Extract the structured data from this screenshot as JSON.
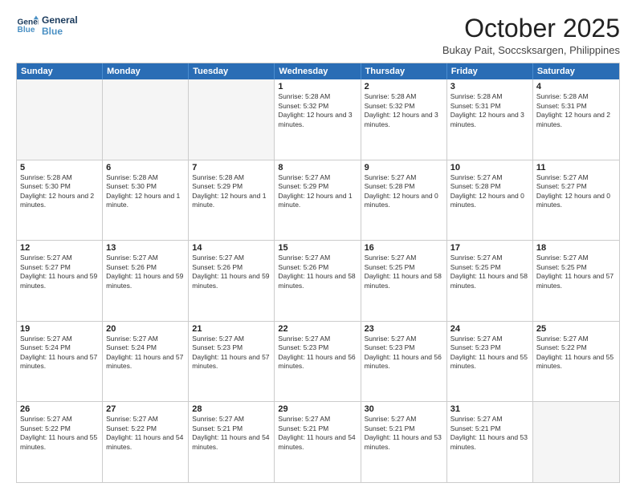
{
  "logo": {
    "line1": "General",
    "line2": "Blue"
  },
  "title": "October 2025",
  "subtitle": "Bukay Pait, Soccsksargen, Philippines",
  "header": {
    "days": [
      "Sunday",
      "Monday",
      "Tuesday",
      "Wednesday",
      "Thursday",
      "Friday",
      "Saturday"
    ]
  },
  "rows": [
    [
      {
        "day": "",
        "sunrise": "",
        "sunset": "",
        "daylight": "",
        "empty": true
      },
      {
        "day": "",
        "sunrise": "",
        "sunset": "",
        "daylight": "",
        "empty": true
      },
      {
        "day": "",
        "sunrise": "",
        "sunset": "",
        "daylight": "",
        "empty": true
      },
      {
        "day": "1",
        "sunrise": "Sunrise: 5:28 AM",
        "sunset": "Sunset: 5:32 PM",
        "daylight": "Daylight: 12 hours and 3 minutes."
      },
      {
        "day": "2",
        "sunrise": "Sunrise: 5:28 AM",
        "sunset": "Sunset: 5:32 PM",
        "daylight": "Daylight: 12 hours and 3 minutes."
      },
      {
        "day": "3",
        "sunrise": "Sunrise: 5:28 AM",
        "sunset": "Sunset: 5:31 PM",
        "daylight": "Daylight: 12 hours and 3 minutes."
      },
      {
        "day": "4",
        "sunrise": "Sunrise: 5:28 AM",
        "sunset": "Sunset: 5:31 PM",
        "daylight": "Daylight: 12 hours and 2 minutes."
      }
    ],
    [
      {
        "day": "5",
        "sunrise": "Sunrise: 5:28 AM",
        "sunset": "Sunset: 5:30 PM",
        "daylight": "Daylight: 12 hours and 2 minutes."
      },
      {
        "day": "6",
        "sunrise": "Sunrise: 5:28 AM",
        "sunset": "Sunset: 5:30 PM",
        "daylight": "Daylight: 12 hours and 1 minute."
      },
      {
        "day": "7",
        "sunrise": "Sunrise: 5:28 AM",
        "sunset": "Sunset: 5:29 PM",
        "daylight": "Daylight: 12 hours and 1 minute."
      },
      {
        "day": "8",
        "sunrise": "Sunrise: 5:27 AM",
        "sunset": "Sunset: 5:29 PM",
        "daylight": "Daylight: 12 hours and 1 minute."
      },
      {
        "day": "9",
        "sunrise": "Sunrise: 5:27 AM",
        "sunset": "Sunset: 5:28 PM",
        "daylight": "Daylight: 12 hours and 0 minutes."
      },
      {
        "day": "10",
        "sunrise": "Sunrise: 5:27 AM",
        "sunset": "Sunset: 5:28 PM",
        "daylight": "Daylight: 12 hours and 0 minutes."
      },
      {
        "day": "11",
        "sunrise": "Sunrise: 5:27 AM",
        "sunset": "Sunset: 5:27 PM",
        "daylight": "Daylight: 12 hours and 0 minutes."
      }
    ],
    [
      {
        "day": "12",
        "sunrise": "Sunrise: 5:27 AM",
        "sunset": "Sunset: 5:27 PM",
        "daylight": "Daylight: 11 hours and 59 minutes."
      },
      {
        "day": "13",
        "sunrise": "Sunrise: 5:27 AM",
        "sunset": "Sunset: 5:26 PM",
        "daylight": "Daylight: 11 hours and 59 minutes."
      },
      {
        "day": "14",
        "sunrise": "Sunrise: 5:27 AM",
        "sunset": "Sunset: 5:26 PM",
        "daylight": "Daylight: 11 hours and 59 minutes."
      },
      {
        "day": "15",
        "sunrise": "Sunrise: 5:27 AM",
        "sunset": "Sunset: 5:26 PM",
        "daylight": "Daylight: 11 hours and 58 minutes."
      },
      {
        "day": "16",
        "sunrise": "Sunrise: 5:27 AM",
        "sunset": "Sunset: 5:25 PM",
        "daylight": "Daylight: 11 hours and 58 minutes."
      },
      {
        "day": "17",
        "sunrise": "Sunrise: 5:27 AM",
        "sunset": "Sunset: 5:25 PM",
        "daylight": "Daylight: 11 hours and 58 minutes."
      },
      {
        "day": "18",
        "sunrise": "Sunrise: 5:27 AM",
        "sunset": "Sunset: 5:25 PM",
        "daylight": "Daylight: 11 hours and 57 minutes."
      }
    ],
    [
      {
        "day": "19",
        "sunrise": "Sunrise: 5:27 AM",
        "sunset": "Sunset: 5:24 PM",
        "daylight": "Daylight: 11 hours and 57 minutes."
      },
      {
        "day": "20",
        "sunrise": "Sunrise: 5:27 AM",
        "sunset": "Sunset: 5:24 PM",
        "daylight": "Daylight: 11 hours and 57 minutes."
      },
      {
        "day": "21",
        "sunrise": "Sunrise: 5:27 AM",
        "sunset": "Sunset: 5:23 PM",
        "daylight": "Daylight: 11 hours and 57 minutes."
      },
      {
        "day": "22",
        "sunrise": "Sunrise: 5:27 AM",
        "sunset": "Sunset: 5:23 PM",
        "daylight": "Daylight: 11 hours and 56 minutes."
      },
      {
        "day": "23",
        "sunrise": "Sunrise: 5:27 AM",
        "sunset": "Sunset: 5:23 PM",
        "daylight": "Daylight: 11 hours and 56 minutes."
      },
      {
        "day": "24",
        "sunrise": "Sunrise: 5:27 AM",
        "sunset": "Sunset: 5:23 PM",
        "daylight": "Daylight: 11 hours and 55 minutes."
      },
      {
        "day": "25",
        "sunrise": "Sunrise: 5:27 AM",
        "sunset": "Sunset: 5:22 PM",
        "daylight": "Daylight: 11 hours and 55 minutes."
      }
    ],
    [
      {
        "day": "26",
        "sunrise": "Sunrise: 5:27 AM",
        "sunset": "Sunset: 5:22 PM",
        "daylight": "Daylight: 11 hours and 55 minutes."
      },
      {
        "day": "27",
        "sunrise": "Sunrise: 5:27 AM",
        "sunset": "Sunset: 5:22 PM",
        "daylight": "Daylight: 11 hours and 54 minutes."
      },
      {
        "day": "28",
        "sunrise": "Sunrise: 5:27 AM",
        "sunset": "Sunset: 5:21 PM",
        "daylight": "Daylight: 11 hours and 54 minutes."
      },
      {
        "day": "29",
        "sunrise": "Sunrise: 5:27 AM",
        "sunset": "Sunset: 5:21 PM",
        "daylight": "Daylight: 11 hours and 54 minutes."
      },
      {
        "day": "30",
        "sunrise": "Sunrise: 5:27 AM",
        "sunset": "Sunset: 5:21 PM",
        "daylight": "Daylight: 11 hours and 53 minutes."
      },
      {
        "day": "31",
        "sunrise": "Sunrise: 5:27 AM",
        "sunset": "Sunset: 5:21 PM",
        "daylight": "Daylight: 11 hours and 53 minutes."
      },
      {
        "day": "",
        "sunrise": "",
        "sunset": "",
        "daylight": "",
        "empty": true
      }
    ]
  ]
}
